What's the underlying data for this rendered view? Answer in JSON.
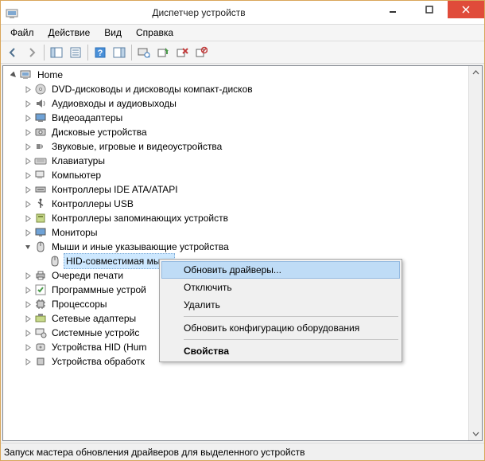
{
  "title": "Диспетчер устройств",
  "menu": {
    "file": "Файл",
    "action": "Действие",
    "view": "Вид",
    "help": "Справка"
  },
  "tree": {
    "root": "Home",
    "categories": [
      "DVD-дисководы и дисководы компакт-дисков",
      "Аудиовходы и аудиовыходы",
      "Видеоадаптеры",
      "Дисковые устройства",
      "Звуковые, игровые и видеоустройства",
      "Клавиатуры",
      "Компьютер",
      "Контроллеры IDE ATA/ATAPI",
      "Контроллеры USB",
      "Контроллеры запоминающих устройств",
      "Мониторы",
      "Мыши и иные указывающие устройства",
      "Очереди печати",
      "Программные устрой",
      "Процессоры",
      "Сетевые адаптеры",
      "Системные устройс",
      "Устройства HID (Hum",
      "Устройства обработк"
    ],
    "selected_child": "HID-совместимая мышь"
  },
  "context_menu": {
    "update": "Обновить драйверы...",
    "disable": "Отключить",
    "delete": "Удалить",
    "scan": "Обновить конфигурацию оборудования",
    "properties": "Свойства"
  },
  "status": "Запуск мастера обновления драйверов для выделенного устройств"
}
